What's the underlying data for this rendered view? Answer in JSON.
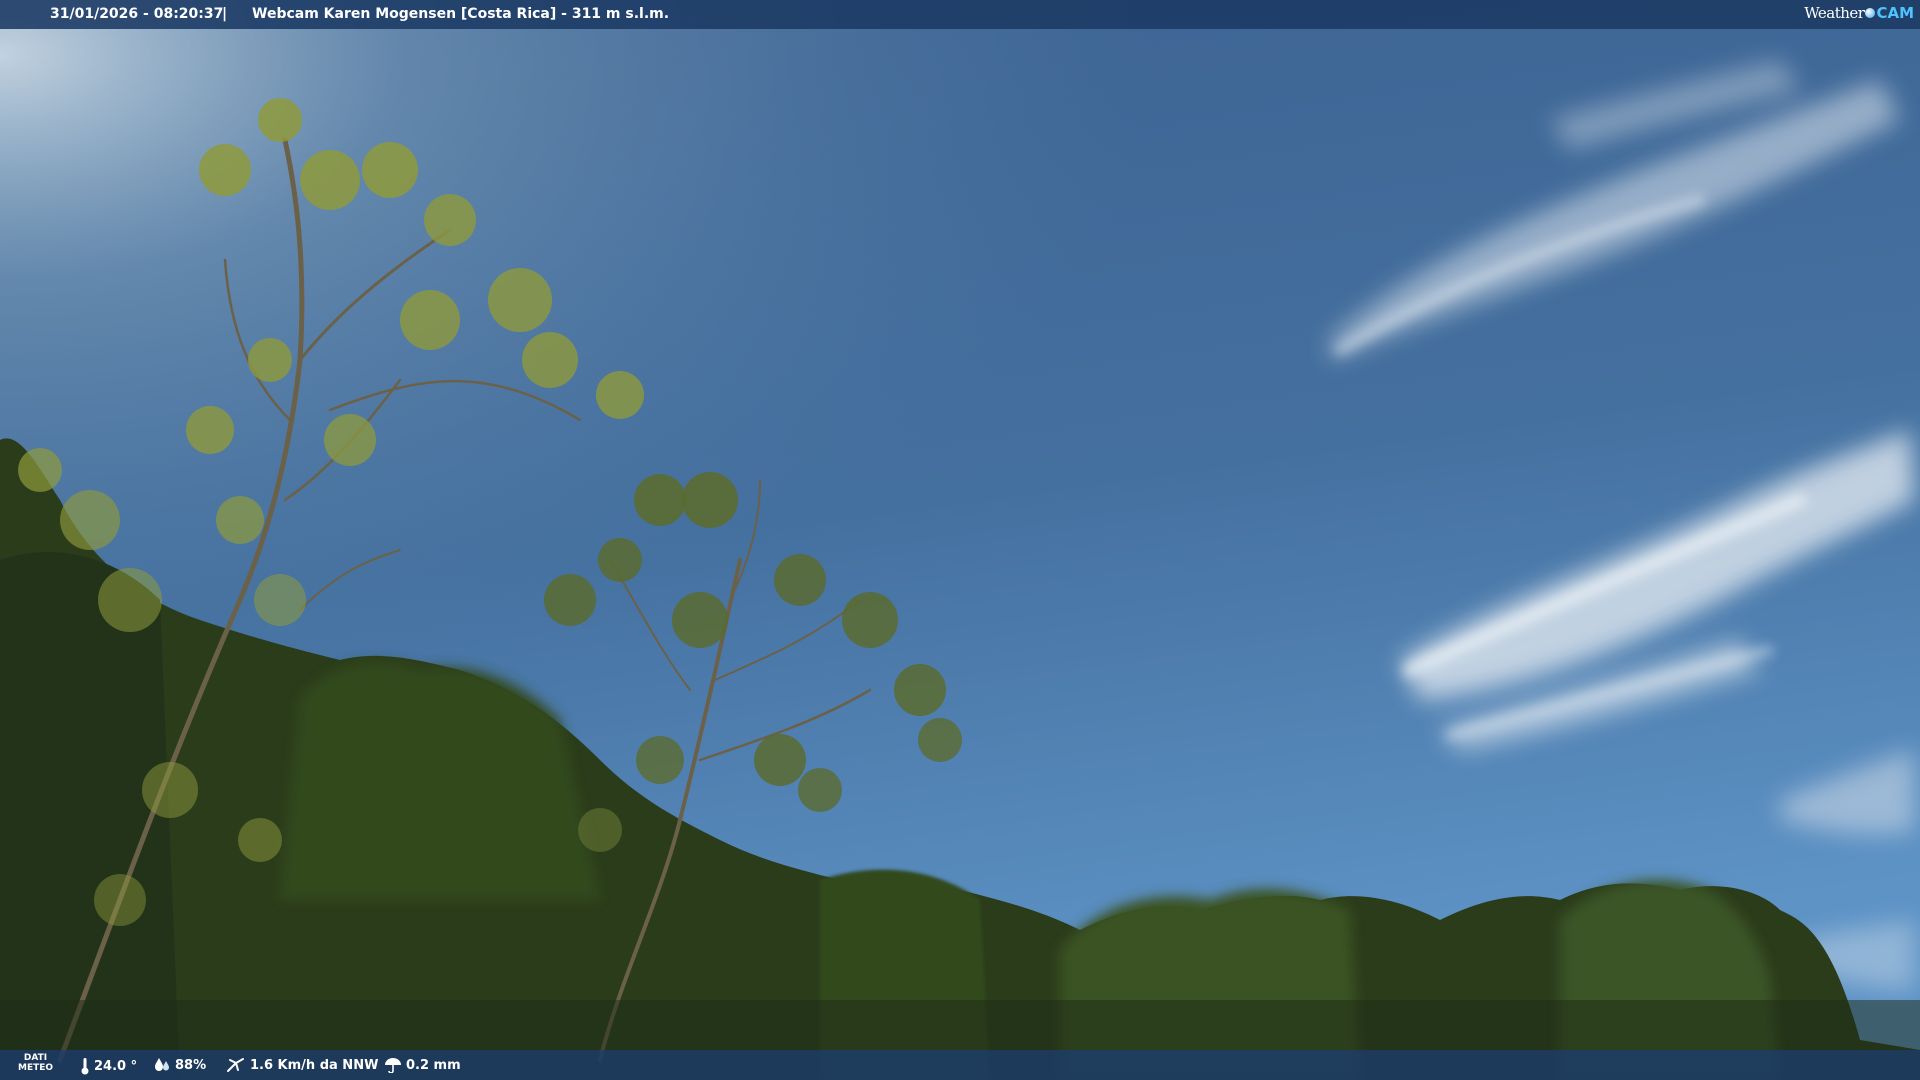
{
  "header": {
    "timestamp": "31/01/2026 - 08:20:37",
    "separator": "|",
    "title": "Webcam Karen Mogensen [Costa Rica] - 311 m s.l.m.",
    "logo_weather": "Weather",
    "logo_cam": "CAM"
  },
  "footer": {
    "dati_line1": "DATI",
    "dati_line2": "METEO",
    "temperature": "24.0 °",
    "humidity": "88%",
    "wind": "1.6 Km/h da NNW",
    "rain": "0.2 mm"
  },
  "icons": {
    "temperature": "thermometer-icon",
    "humidity": "drops-icon",
    "wind": "wind-icon",
    "rain": "rain-icon"
  },
  "colors": {
    "bar": "#1b3a64",
    "sky_top": "#3d6291",
    "sky_bottom": "#5c8fc4",
    "foliage": "#2a3e1a",
    "logo_accent": "#4fc3ff"
  }
}
